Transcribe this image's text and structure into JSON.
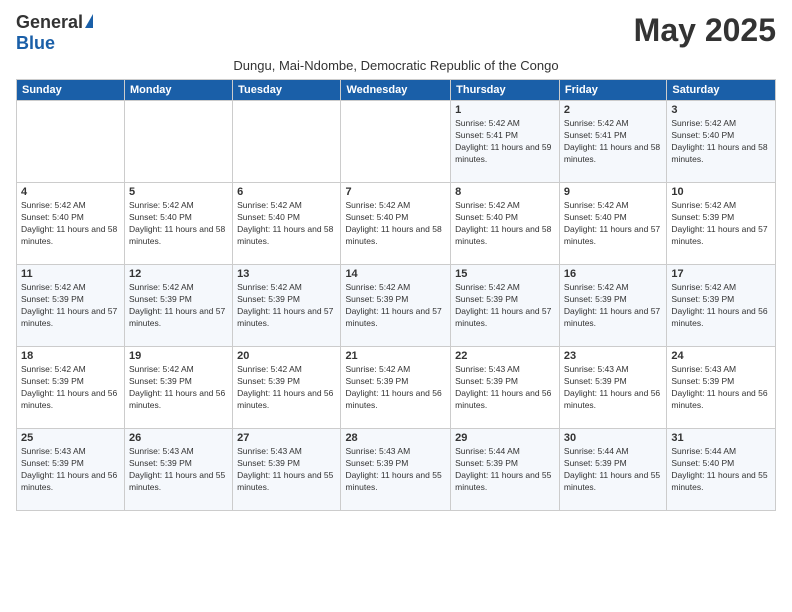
{
  "logo": {
    "general": "General",
    "blue": "Blue"
  },
  "title": "May 2025",
  "subtitle": "Dungu, Mai-Ndombe, Democratic Republic of the Congo",
  "headers": [
    "Sunday",
    "Monday",
    "Tuesday",
    "Wednesday",
    "Thursday",
    "Friday",
    "Saturday"
  ],
  "weeks": [
    [
      {
        "day": "",
        "info": ""
      },
      {
        "day": "",
        "info": ""
      },
      {
        "day": "",
        "info": ""
      },
      {
        "day": "",
        "info": ""
      },
      {
        "day": "1",
        "info": "Sunrise: 5:42 AM\nSunset: 5:41 PM\nDaylight: 11 hours and 59 minutes."
      },
      {
        "day": "2",
        "info": "Sunrise: 5:42 AM\nSunset: 5:41 PM\nDaylight: 11 hours and 58 minutes."
      },
      {
        "day": "3",
        "info": "Sunrise: 5:42 AM\nSunset: 5:40 PM\nDaylight: 11 hours and 58 minutes."
      }
    ],
    [
      {
        "day": "4",
        "info": "Sunrise: 5:42 AM\nSunset: 5:40 PM\nDaylight: 11 hours and 58 minutes."
      },
      {
        "day": "5",
        "info": "Sunrise: 5:42 AM\nSunset: 5:40 PM\nDaylight: 11 hours and 58 minutes."
      },
      {
        "day": "6",
        "info": "Sunrise: 5:42 AM\nSunset: 5:40 PM\nDaylight: 11 hours and 58 minutes."
      },
      {
        "day": "7",
        "info": "Sunrise: 5:42 AM\nSunset: 5:40 PM\nDaylight: 11 hours and 58 minutes."
      },
      {
        "day": "8",
        "info": "Sunrise: 5:42 AM\nSunset: 5:40 PM\nDaylight: 11 hours and 58 minutes."
      },
      {
        "day": "9",
        "info": "Sunrise: 5:42 AM\nSunset: 5:40 PM\nDaylight: 11 hours and 57 minutes."
      },
      {
        "day": "10",
        "info": "Sunrise: 5:42 AM\nSunset: 5:39 PM\nDaylight: 11 hours and 57 minutes."
      }
    ],
    [
      {
        "day": "11",
        "info": "Sunrise: 5:42 AM\nSunset: 5:39 PM\nDaylight: 11 hours and 57 minutes."
      },
      {
        "day": "12",
        "info": "Sunrise: 5:42 AM\nSunset: 5:39 PM\nDaylight: 11 hours and 57 minutes."
      },
      {
        "day": "13",
        "info": "Sunrise: 5:42 AM\nSunset: 5:39 PM\nDaylight: 11 hours and 57 minutes."
      },
      {
        "day": "14",
        "info": "Sunrise: 5:42 AM\nSunset: 5:39 PM\nDaylight: 11 hours and 57 minutes."
      },
      {
        "day": "15",
        "info": "Sunrise: 5:42 AM\nSunset: 5:39 PM\nDaylight: 11 hours and 57 minutes."
      },
      {
        "day": "16",
        "info": "Sunrise: 5:42 AM\nSunset: 5:39 PM\nDaylight: 11 hours and 57 minutes."
      },
      {
        "day": "17",
        "info": "Sunrise: 5:42 AM\nSunset: 5:39 PM\nDaylight: 11 hours and 56 minutes."
      }
    ],
    [
      {
        "day": "18",
        "info": "Sunrise: 5:42 AM\nSunset: 5:39 PM\nDaylight: 11 hours and 56 minutes."
      },
      {
        "day": "19",
        "info": "Sunrise: 5:42 AM\nSunset: 5:39 PM\nDaylight: 11 hours and 56 minutes."
      },
      {
        "day": "20",
        "info": "Sunrise: 5:42 AM\nSunset: 5:39 PM\nDaylight: 11 hours and 56 minutes."
      },
      {
        "day": "21",
        "info": "Sunrise: 5:42 AM\nSunset: 5:39 PM\nDaylight: 11 hours and 56 minutes."
      },
      {
        "day": "22",
        "info": "Sunrise: 5:43 AM\nSunset: 5:39 PM\nDaylight: 11 hours and 56 minutes."
      },
      {
        "day": "23",
        "info": "Sunrise: 5:43 AM\nSunset: 5:39 PM\nDaylight: 11 hours and 56 minutes."
      },
      {
        "day": "24",
        "info": "Sunrise: 5:43 AM\nSunset: 5:39 PM\nDaylight: 11 hours and 56 minutes."
      }
    ],
    [
      {
        "day": "25",
        "info": "Sunrise: 5:43 AM\nSunset: 5:39 PM\nDaylight: 11 hours and 56 minutes."
      },
      {
        "day": "26",
        "info": "Sunrise: 5:43 AM\nSunset: 5:39 PM\nDaylight: 11 hours and 55 minutes."
      },
      {
        "day": "27",
        "info": "Sunrise: 5:43 AM\nSunset: 5:39 PM\nDaylight: 11 hours and 55 minutes."
      },
      {
        "day": "28",
        "info": "Sunrise: 5:43 AM\nSunset: 5:39 PM\nDaylight: 11 hours and 55 minutes."
      },
      {
        "day": "29",
        "info": "Sunrise: 5:44 AM\nSunset: 5:39 PM\nDaylight: 11 hours and 55 minutes."
      },
      {
        "day": "30",
        "info": "Sunrise: 5:44 AM\nSunset: 5:39 PM\nDaylight: 11 hours and 55 minutes."
      },
      {
        "day": "31",
        "info": "Sunrise: 5:44 AM\nSunset: 5:40 PM\nDaylight: 11 hours and 55 minutes."
      }
    ]
  ]
}
